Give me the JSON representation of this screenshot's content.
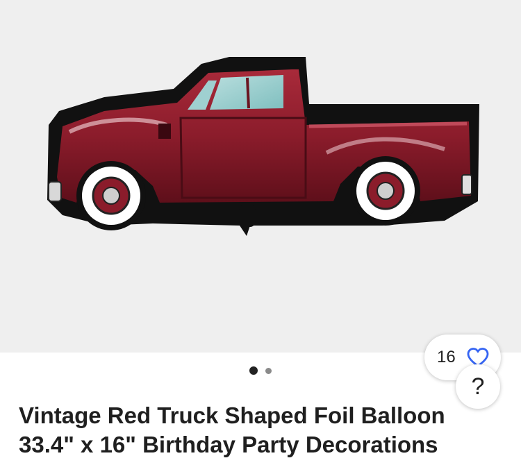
{
  "listing": {
    "title": "Vintage Red Truck Shaped Foil Balloon 33.4\" x 16\" Birthday Party Decorations",
    "image": {
      "subject": "red-truck-foil-balloon",
      "current_index": 1,
      "total_images": 2
    },
    "watch": {
      "count": "16",
      "icon": "heart-outline-icon"
    },
    "help": {
      "label": "?"
    }
  },
  "colors": {
    "gallery_background": "#efefef",
    "truck_red": "#8b1c2b",
    "heart_blue": "#3665f3",
    "text": "#1f1f1f"
  }
}
